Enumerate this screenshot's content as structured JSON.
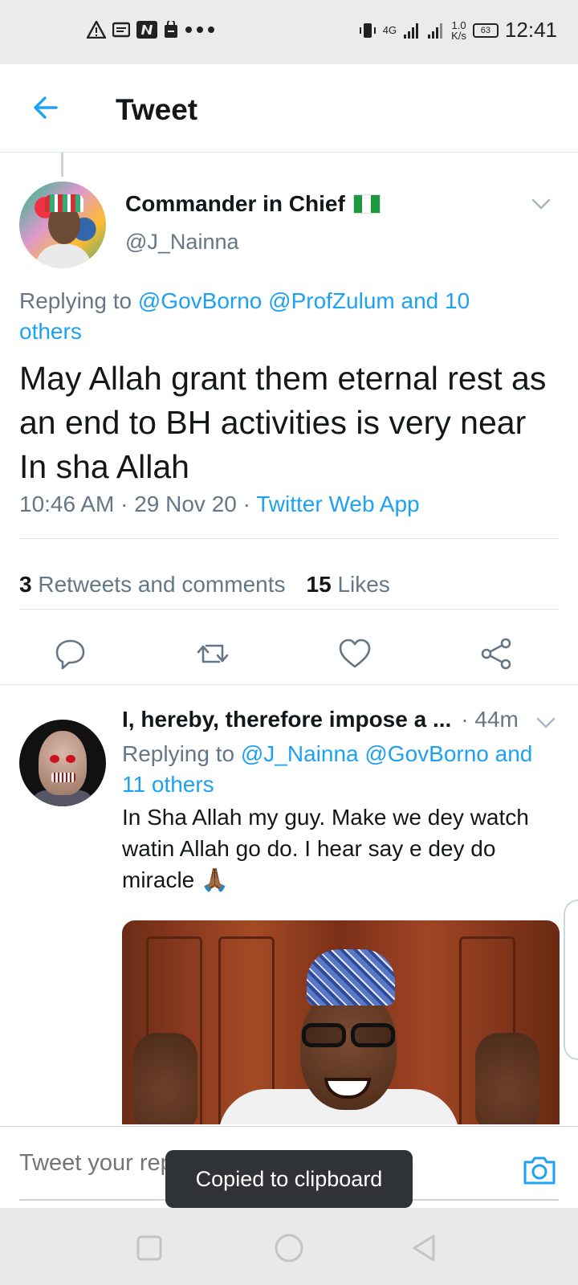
{
  "status_bar": {
    "left_icons": [
      "warning-icon",
      "message-icon",
      "n-icon",
      "bag-icon",
      "more-dots-icon"
    ],
    "network_label": "4G",
    "speed_value": "1.0",
    "speed_unit": "K/s",
    "battery": "63",
    "time": "12:41"
  },
  "header": {
    "title": "Tweet"
  },
  "main_tweet": {
    "author_name": "Commander in Chief",
    "author_handle": "@J_Nainna",
    "replying_prefix": "Replying to",
    "replying_to": "@GovBorno @ProfZulum and 10 others",
    "text": "May Allah grant them eternal rest as an end to BH activities is very near In sha Allah",
    "time": "10:46 AM",
    "date": "29 Nov 20",
    "source": "Twitter Web App",
    "retweets_count": "3",
    "retweets_label": "Retweets and comments",
    "likes_count": "15",
    "likes_label": "Likes"
  },
  "reply_tweet": {
    "author_name": "I, hereby, therefore impose a ...",
    "time": "· 44m",
    "replying_prefix": "Replying to",
    "replying_to": "@J_Nainna @GovBorno and 11 others",
    "text": "In Sha Allah my guy. Make we dey watch watin Allah go do. I hear say e dey do miracle 🙏🏾"
  },
  "compose": {
    "placeholder": "Tweet your reply"
  },
  "toast": {
    "message": "Copied to clipboard"
  },
  "colors": {
    "accent": "#1da1f2",
    "text_primary": "#14171a",
    "text_secondary": "#657786",
    "divider": "#e1e8ed",
    "toast_bg": "#2f3337"
  }
}
